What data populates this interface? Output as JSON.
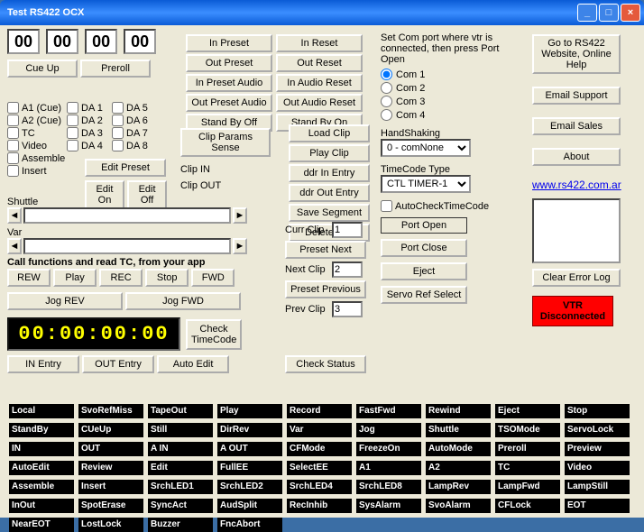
{
  "window": {
    "title": "Test RS422 OCX"
  },
  "counters": [
    "00",
    "00",
    "00",
    "00"
  ],
  "topBtns": {
    "cueUp": "Cue Up",
    "preroll": "Preroll"
  },
  "leftChecks": {
    "col1": [
      "A1 (Cue)",
      "A2 (Cue)",
      "TC",
      "Video",
      "Assemble",
      "Insert"
    ],
    "col2": [
      "DA 1",
      "DA 2",
      "DA 3",
      "DA 4"
    ],
    "col3": [
      "DA 5",
      "DA 6",
      "DA 7",
      "DA 8"
    ]
  },
  "editBtns": {
    "editPreset": "Edit Preset",
    "editOn": "Edit On",
    "editOff": "Edit Off"
  },
  "sliders": {
    "shuttle": "Shuttle",
    "var": "Var"
  },
  "callText": "Call functions and read TC, from your app",
  "transport": {
    "rew": "REW",
    "play": "Play",
    "rec": "REC",
    "stop": "Stop",
    "fwd": "FWD"
  },
  "jog": {
    "rev": "Jog REV",
    "fwd": "Jog FWD"
  },
  "timecode": "00:00:00:00",
  "checkTC": "Check\nTimeCode",
  "entry": {
    "in": "IN Entry",
    "out": "OUT Entry",
    "auto": "Auto Edit"
  },
  "presetCol": [
    "In Preset",
    "Out Preset",
    "In Preset Audio",
    "Out Preset Audio",
    "Stand By Off"
  ],
  "resetCol": [
    "In Reset",
    "Out Reset",
    "In Audio Reset",
    "Out Audio Reset",
    "Stand By On"
  ],
  "clipParams": "Clip Params Sense",
  "clipLbls": {
    "in": "Clip   IN",
    "out": "Clip OUT"
  },
  "clipBtns": [
    "Load Clip",
    "Play Clip",
    "ddr In Entry",
    "ddr Out Entry",
    "Save Segment",
    "Delete Clip"
  ],
  "clipNav": {
    "curr": {
      "lbl": "Curr Clip",
      "val": "1"
    },
    "presetNext": "Preset Next",
    "next": {
      "lbl": "Next Clip",
      "val": "2"
    },
    "presetPrev": "Preset Previous",
    "prev": {
      "lbl": "Prev Clip",
      "val": "3"
    }
  },
  "checkStatus": "Check Status",
  "comText": "Set Com port where vtr is connected, then press Port Open",
  "coms": [
    "Com 1",
    "Com 2",
    "Com 3",
    "Com 4"
  ],
  "hand": {
    "lbl": "HandShaking",
    "val": "0 - comNone"
  },
  "tcType": {
    "lbl": "TimeCode Type",
    "val": "CTL TIMER-1"
  },
  "autoCheck": "AutoCheckTimeCode",
  "portBtns": {
    "open": "Port Open",
    "close": "Port Close",
    "eject": "Eject",
    "servo": "Servo Ref Select"
  },
  "rightBtns": {
    "help": "Go to RS422 Website, Online Help",
    "support": "Email Support",
    "sales": "Email Sales",
    "about": "About",
    "clear": "Clear Error Log"
  },
  "link": "www.rs422.com.ar",
  "vtr": "VTR Disconnected",
  "status": [
    [
      "Local",
      "SvoRefMiss",
      "TapeOut",
      "Play",
      "Record",
      "FastFwd",
      "Rewind",
      "Eject",
      "Stop"
    ],
    [
      "StandBy",
      "CUeUp",
      "Still",
      "DirRev",
      "Var",
      "Jog",
      "Shuttle",
      "TSOMode",
      "ServoLock"
    ],
    [
      "IN",
      "OUT",
      "A IN",
      "A OUT",
      "CFMode",
      "FreezeOn",
      "AutoMode",
      "Preroll",
      "Preview"
    ],
    [
      "AutoEdit",
      "Review",
      "Edit",
      "FullEE",
      "SelectEE",
      "A1",
      "A2",
      "TC",
      "Video"
    ],
    [
      "Assemble",
      "Insert",
      "SrchLED1",
      "SrchLED2",
      "SrchLED4",
      "SrchLED8",
      "LampRev",
      "LampFwd",
      "LampStill"
    ],
    [
      "InOut",
      "SpotErase",
      "SyncAct",
      "AudSplit",
      "RecInhib",
      "SysAlarm",
      "SvoAlarm",
      "CFLock",
      "EOT"
    ],
    [
      "NearEOT",
      "LostLock",
      "Buzzer",
      "FncAbort",
      "",
      "",
      "",
      "",
      ""
    ]
  ]
}
